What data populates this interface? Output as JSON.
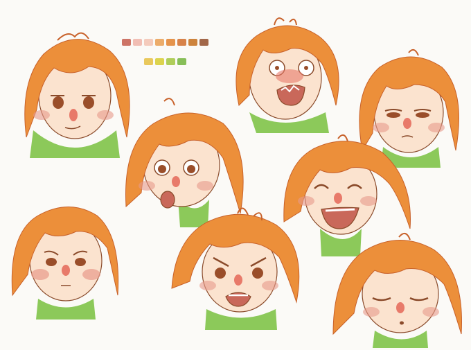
{
  "palette": {
    "row1": [
      "#c9685a",
      "#f0b8ae",
      "#f3c7b6",
      "#eaa55d",
      "#e38a3c",
      "#d4773a",
      "#c9782b",
      "#9a5a3a"
    ],
    "row2": [
      "#e7c34e",
      "#d9cf3e",
      "#a8c94b",
      "#7db84a"
    ]
  },
  "colors": {
    "hair": "#ec8f3a",
    "hair_light": "#f5b35f",
    "hair_dark": "#c8612a",
    "skin": "#fbe3cf",
    "blush": "#e89a8a",
    "nose": "#e87a6a",
    "shirt": "#8cc95a",
    "line": "#8a4a2a",
    "eye": "#9a4e2a"
  },
  "expressions": [
    "neutral",
    "shocked",
    "annoyed",
    "surprised",
    "laughing",
    "sad",
    "angry",
    "sleepy"
  ]
}
